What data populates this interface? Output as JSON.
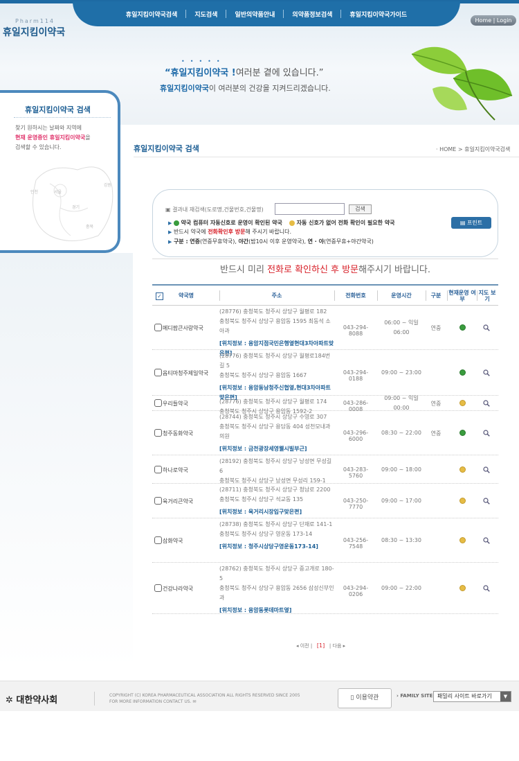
{
  "header": {
    "logo_en": "Pharm114",
    "logo": "휴일지킴이약국",
    "nav": [
      "휴일지킴이약국검색",
      "지도검색",
      "일반의약품안내",
      "의약품정보검색",
      "휴일지킴이약국가이드"
    ],
    "home_login": "Home | Login",
    "slogan1_brand": "“휴일지킴이약국 !",
    "slogan1_rest": "여러분 곁에 있습니다.”",
    "slogan2_brand": "휴일지킴이약국",
    "slogan2_rest": "이 여러분의 건강을 지켜드리겠습니다."
  },
  "sidebar": {
    "title": "휴일지킴이약국 검색",
    "desc1": "찾기 원하시는 날짜와 지역에",
    "desc2_hl": "현재 운영중인 휴일지킴이약국",
    "desc2_rest": "을",
    "desc3": "검색할 수 있습니다.",
    "map_labels": [
      "인천",
      "서울",
      "강원",
      "경기",
      "충북"
    ]
  },
  "page": {
    "title": "휴일지킴이약국 검색",
    "breadcrumb": "· HOME > 휴일지킴이약국검색"
  },
  "search": {
    "label": "결과내 재검색(도로명,건물번호,건물명)",
    "value": "",
    "button": "검색",
    "print": "프린트",
    "legend_green": "약국 컴퓨터 자동신호로 운영이 확인된 약국",
    "legend_yellow": "자동 신호가 없어 전화 확인이 필요한 약국",
    "note_pre": "반드시 약국에",
    "note_red": "전화확인후 방문",
    "note_post": "해 주시기 바랍니다.",
    "type_label": "구분 :",
    "type_b1": "연중",
    "type_t1": "(연중무휴약국),",
    "type_b2": "야간",
    "type_t2": "(밤10시 이후 운영약국),",
    "type_b3": "연 · 야",
    "type_t3": "(연중무휴+야간약국)"
  },
  "notice": {
    "pre": "반드시 미리 ",
    "red": "전화로 확인하신 후 방문",
    "post": "해주시기 바랍니다."
  },
  "table": {
    "headers": {
      "check": "✓",
      "name": "약국명",
      "address": "주소",
      "phone": "전화번호",
      "hours": "운영시간",
      "type": "구분",
      "status": "현재운영 여부",
      "map": "지도 보기"
    },
    "rows": [
      {
        "name": "메디팜큰사랑약국",
        "addr": [
          "(28776) 충청북도 청주시 상당구 월평로 182",
          "충청북도 청주시 상당구 용암동 1595 최동석 소아과"
        ],
        "loc": "[위치정보 : 용암지점국민은행옆현대3차아파트맞은편]",
        "phone": "043-294-8088",
        "hours": [
          "06:00 ~ 익일",
          "06:00"
        ],
        "type": "연중",
        "status": "green"
      },
      {
        "name": "옵티마청주제일약국",
        "addr": [
          "(28776) 충청북도 청주시 상당구 월평로184번길 5",
          "충청북도 청주시 상당구 용암동 1667"
        ],
        "loc": "[위치정보 : 용암동남청주신협옆,현대3차아파트맞은편]",
        "phone": "043-294-0188",
        "hours": [
          "09:00 ~ 23:00"
        ],
        "type": "",
        "status": "green"
      },
      {
        "name": "우리들약국",
        "addr": [
          "(28776) 충청북도 청주시 상당구 월평로 174",
          "충청북도 청주시 상당구 용암동 1592-2"
        ],
        "loc": "",
        "phone": "043-286-0008",
        "hours": [
          "09:00 ~ 익일",
          "00:00"
        ],
        "type": "연중",
        "status": "yellow"
      },
      {
        "name": "청주동화약국",
        "addr": [
          "(28744) 충청북도 청주시 상당구 수영로 307",
          "충청북도 청주시 상당구 용담동 404 성천모내과의원"
        ],
        "loc": "[위치정보 : 금천광장세영웰시빌부근]",
        "phone": "043-296-6000",
        "hours": [
          "08:30 ~ 22:00"
        ],
        "type": "연중",
        "status": "green"
      },
      {
        "name": "하나로약국",
        "addr": [
          "(28192) 충청북도 청주시 상당구 낭성면 무성길 6",
          "충청북도 청주시 상당구 낭성면 무성리 159-1"
        ],
        "loc": "",
        "phone": "043-283-5760",
        "hours": [
          "09:00 ~ 18:00"
        ],
        "type": "",
        "status": "yellow"
      },
      {
        "name": "육거리큰약국",
        "addr": [
          "(28711) 충청북도 청주시 상당구 청남로 2200",
          "충청북도 청주시 상당구 석교동 135"
        ],
        "loc": "[위치정보 : 육거리시장입구맞은편]",
        "phone": "043-250-7770",
        "hours": [
          "09:00 ~ 17:00"
        ],
        "type": "",
        "status": "yellow"
      },
      {
        "name": "삼화약국",
        "addr": [
          "(28738) 충청북도 청주시 상당구 단재로 141-1",
          "충청북도 청주시 상당구 영운동 173-14"
        ],
        "loc": "[위치정보 : 청주시상당구영운동173-14]",
        "phone": "043-256-7548",
        "hours": [
          "08:30 ~ 13:30"
        ],
        "type": "",
        "status": "yellow"
      },
      {
        "name": "건강나라약국",
        "addr": [
          "(28762) 충청북도 청주시 상당구 중고개로 180-5",
          "충청북도 청주시 상당구 용암동 2656 삼성신부인과"
        ],
        "loc": "[위치정보 : 용암동롯데마트옆]",
        "phone": "043-294-0206",
        "hours": [
          "09:00 ~ 22:00"
        ],
        "type": "",
        "status": "yellow"
      }
    ]
  },
  "pager": {
    "prev": "◂ 이전",
    "current": "[1]",
    "next": "다음 ▸"
  },
  "footer": {
    "logo": "대한약사회",
    "copyright1": "COPYRIGHT (C) KOREA PHARMACEUTICAL ASSOCIATION ALL RIGHTS RESERVED SINCE 2005",
    "copyright2": "FOR MORE INFORMATION CONTACT US.",
    "terms": "이용약관",
    "family_label": "› FAMILY SITE",
    "family_select": "패밀리 사이트 바로가기"
  },
  "colors": {
    "primary": "#1f6fa8",
    "accent_red": "#d71f27",
    "status_green": "#3a9c3e",
    "status_yellow": "#e6bc45"
  }
}
